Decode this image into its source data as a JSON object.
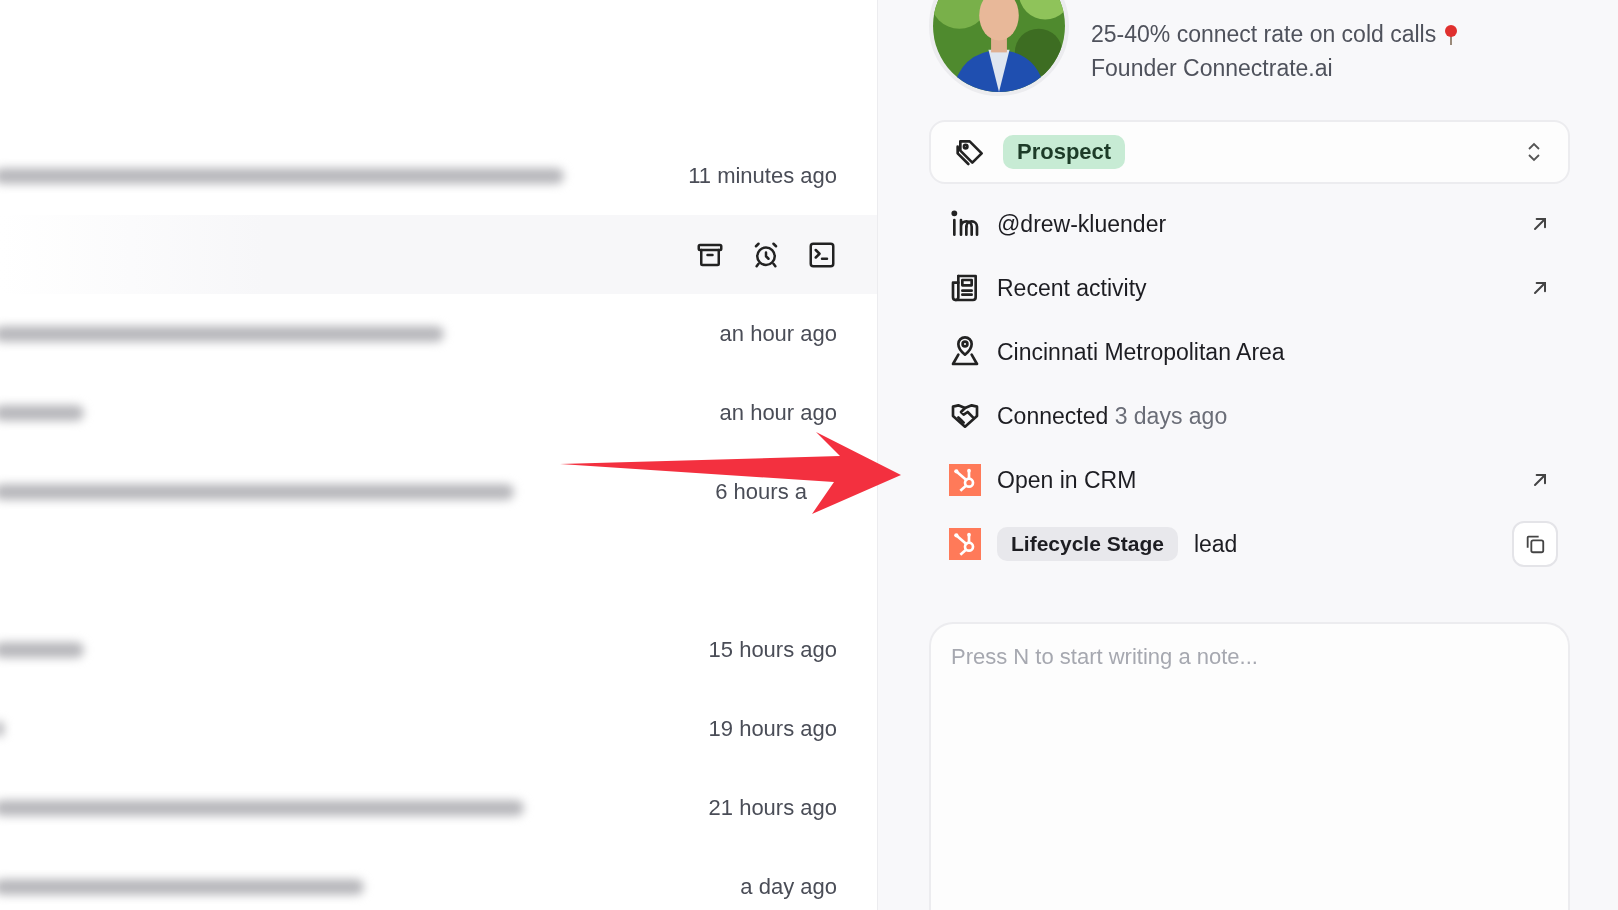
{
  "messages": [
    {
      "time": "11 minutes ago",
      "hovered": false
    },
    {
      "hovered": true
    },
    {
      "time": "an hour ago",
      "hovered": false
    },
    {
      "time": "an hour ago",
      "hovered": false
    },
    {
      "time": "6 hours a",
      "hovered": false
    },
    {
      "hovered": false
    },
    {
      "time": "15 hours ago",
      "hovered": false
    },
    {
      "time": "19 hours ago",
      "hovered": false
    },
    {
      "time": "21 hours ago",
      "hovered": false
    },
    {
      "time": "a day ago",
      "hovered": false
    }
  ],
  "profile": {
    "headline": [
      "25-40% connect rate on cold calls",
      "Founder Connectrate.ai"
    ]
  },
  "status": {
    "label": "Prospect"
  },
  "details": [
    {
      "kind": "linkedin",
      "text": "@drew-kluender",
      "external": true
    },
    {
      "kind": "activity",
      "text": "Recent activity",
      "external": true
    },
    {
      "kind": "location",
      "text": "Cincinnati Metropolitan Area",
      "external": false
    },
    {
      "kind": "connected",
      "text": "Connected",
      "detail": "3 days ago",
      "external": false
    },
    {
      "kind": "crm",
      "text": "Open in CRM",
      "external": true
    },
    {
      "kind": "lifecycle",
      "tag": "Lifecycle Stage",
      "text": "lead",
      "external": false
    }
  ],
  "note": {
    "placeholder": "Press N to start writing a note..."
  }
}
